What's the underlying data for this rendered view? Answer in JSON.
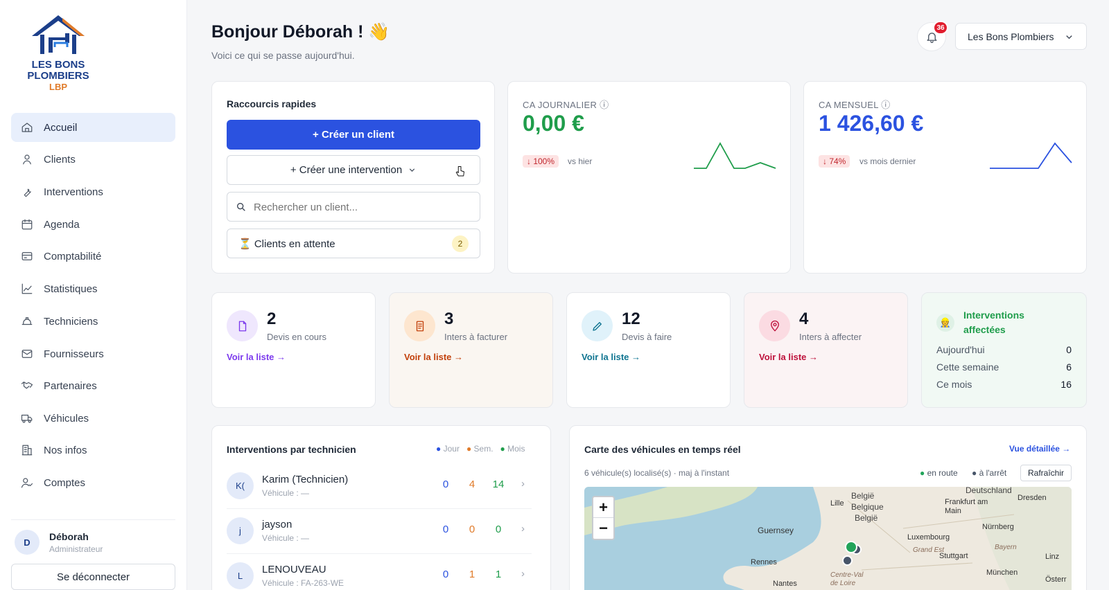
{
  "sidebar": {
    "logo": {
      "line1": "LES BONS",
      "line2": "PLOMBIERS",
      "line3": "LBP"
    },
    "items": [
      {
        "label": "Accueil",
        "icon": "home-icon"
      },
      {
        "label": "Clients",
        "icon": "user-icon"
      },
      {
        "label": "Interventions",
        "icon": "wrench-icon"
      },
      {
        "label": "Agenda",
        "icon": "calendar-icon"
      },
      {
        "label": "Comptabilité",
        "icon": "receipt-icon"
      },
      {
        "label": "Statistiques",
        "icon": "chart-line-icon"
      },
      {
        "label": "Techniciens",
        "icon": "hardhat-icon"
      },
      {
        "label": "Fournisseurs",
        "icon": "mail-icon"
      },
      {
        "label": "Partenaires",
        "icon": "handshake-icon"
      },
      {
        "label": "Véhicules",
        "icon": "truck-icon"
      },
      {
        "label": "Nos infos",
        "icon": "building-icon"
      },
      {
        "label": "Comptes",
        "icon": "user-check-icon"
      }
    ],
    "user": {
      "initial": "D",
      "name": "Déborah",
      "role": "Administrateur"
    },
    "logout_label": "Se déconnecter"
  },
  "header": {
    "greeting": "Bonjour Déborah ! 👋",
    "subtitle": "Voici ce qui se passe aujourd'hui.",
    "notif_count": "36",
    "company_select": "Les Bons Plombiers"
  },
  "shortcuts": {
    "title": "Raccourcis rapides",
    "create_client": "+ Créer un client",
    "create_intervention": "+ Créer une intervention",
    "search_placeholder": "Rechercher un client...",
    "waiting_label": "⏳ Clients en attente",
    "waiting_count": "2"
  },
  "kpi": {
    "daily": {
      "label": "CA JOURNALIER ⓘ",
      "value": "0,00 €",
      "delta": "↓ 100%",
      "vs": "vs hier",
      "color": "#1f9d4b"
    },
    "monthly": {
      "label": "CA MENSUEL ⓘ",
      "value": "1 426,60 €",
      "delta": "↓ 74%",
      "vs": "vs mois dernier",
      "color": "#2b52e0"
    }
  },
  "stats": [
    {
      "value": "2",
      "label": "Devis en cours",
      "link": "Voir la liste →",
      "color": "#7c3aed"
    },
    {
      "value": "3",
      "label": "Inters à facturer",
      "link": "Voir la liste →",
      "color": "#c2410c"
    },
    {
      "value": "12",
      "label": "Devis à faire",
      "link": "Voir la liste →",
      "color": "#0e7490"
    },
    {
      "value": "4",
      "label": "Inters à affecter",
      "link": "Voir la liste →",
      "color": "#be123c"
    }
  ],
  "affected": {
    "title": "Interventions affectées",
    "rows": [
      {
        "label": "Aujourd'hui",
        "value": "0"
      },
      {
        "label": "Cette semaine",
        "value": "6"
      },
      {
        "label": "Ce mois",
        "value": "16"
      }
    ]
  },
  "technicians": {
    "title": "Interventions par technicien",
    "legend": [
      "Jour",
      "Sem.",
      "Mois"
    ],
    "rows": [
      {
        "initials": "K(",
        "name": "Karim (Technicien)",
        "vehicle": "Véhicule : —",
        "day": "0",
        "week": "4",
        "month": "14"
      },
      {
        "initials": "j",
        "name": "jayson",
        "vehicle": "Véhicule : —",
        "day": "0",
        "week": "0",
        "month": "0"
      },
      {
        "initials": "L",
        "name": "LENOUVEAU",
        "vehicle": "Véhicule : FA-263-WE",
        "day": "0",
        "week": "1",
        "month": "1"
      }
    ]
  },
  "map": {
    "title": "Carte des véhicules en temps réel",
    "detail_link": "Vue détaillée →",
    "info": "6 véhicule(s) localisé(s) · maj à l'instant",
    "legend_moving": "en route",
    "legend_stopped": "à l'arrêt",
    "refresh": "Rafraîchir",
    "zoom_in": "+",
    "zoom_out": "−",
    "labels": [
      "Deutschland",
      "België",
      "Belgique",
      "België",
      "Lille",
      "Frankfurt am Main",
      "Dresden",
      "Guernsey",
      "Luxembourg",
      "Nürnberg",
      "Grand Est",
      "Bayern",
      "Rennes",
      "Stuttgart",
      "Linz",
      "München",
      "Nantes",
      "Centre-Val de Loire",
      "Österr"
    ]
  }
}
